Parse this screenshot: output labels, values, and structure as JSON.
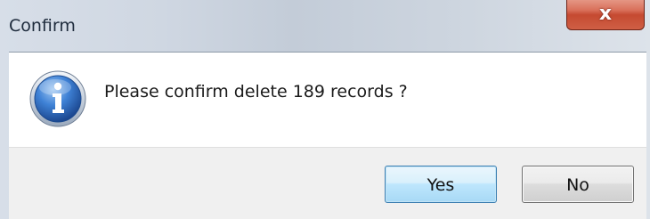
{
  "window": {
    "title": "Confirm",
    "close_label": "x",
    "close_icon": "close-icon"
  },
  "dialog": {
    "icon": "info-icon",
    "message": "Please confirm delete 189 records ?"
  },
  "buttons": {
    "yes_label": "Yes",
    "no_label": "No"
  },
  "colors": {
    "close_button": "#c54a31",
    "default_button_border": "#3c7fb1",
    "info_icon": "#1f5fb0"
  }
}
